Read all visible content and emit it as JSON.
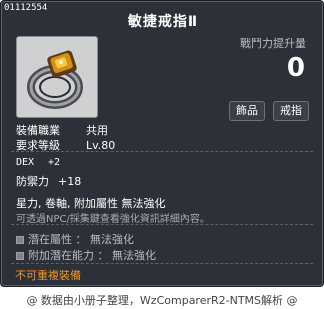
{
  "item": {
    "id": "01112554",
    "name": "敏捷戒指Ⅱ",
    "stat_label": "戰鬥力提升量",
    "stat_value": "0",
    "tags": [
      "飾品",
      "戒指"
    ]
  },
  "requirements": {
    "job_label": "裝備職業",
    "job_value": "共用",
    "level_label": "要求等級",
    "level_value": "Lv.80"
  },
  "stats": {
    "dex_label": "DEX",
    "dex_value": "+2",
    "attack_label": "防禦力",
    "attack_value": "+18",
    "attributes": "星力, 卷軸, 附加屬性 無法強化",
    "note": "可透過NPC/採集鍵查看強化資訊詳細內容。"
  },
  "potentials": [
    {
      "label": "潛在屬性 ： 無法強化"
    },
    {
      "label": "附加潛在能力 ： 無法強化"
    }
  ],
  "unique_notice": "不可重複裝備",
  "footer": "@ 数据由小册子整理，WzComparerR2-NTMS解析 @",
  "colors": {
    "tooltip_bg": "#2c3038",
    "unique": "#f2961c",
    "ring_gem": "#d4900e"
  },
  "icons": {
    "item_icon": "ring-icon",
    "potential_box": "square-bullet-icon"
  }
}
